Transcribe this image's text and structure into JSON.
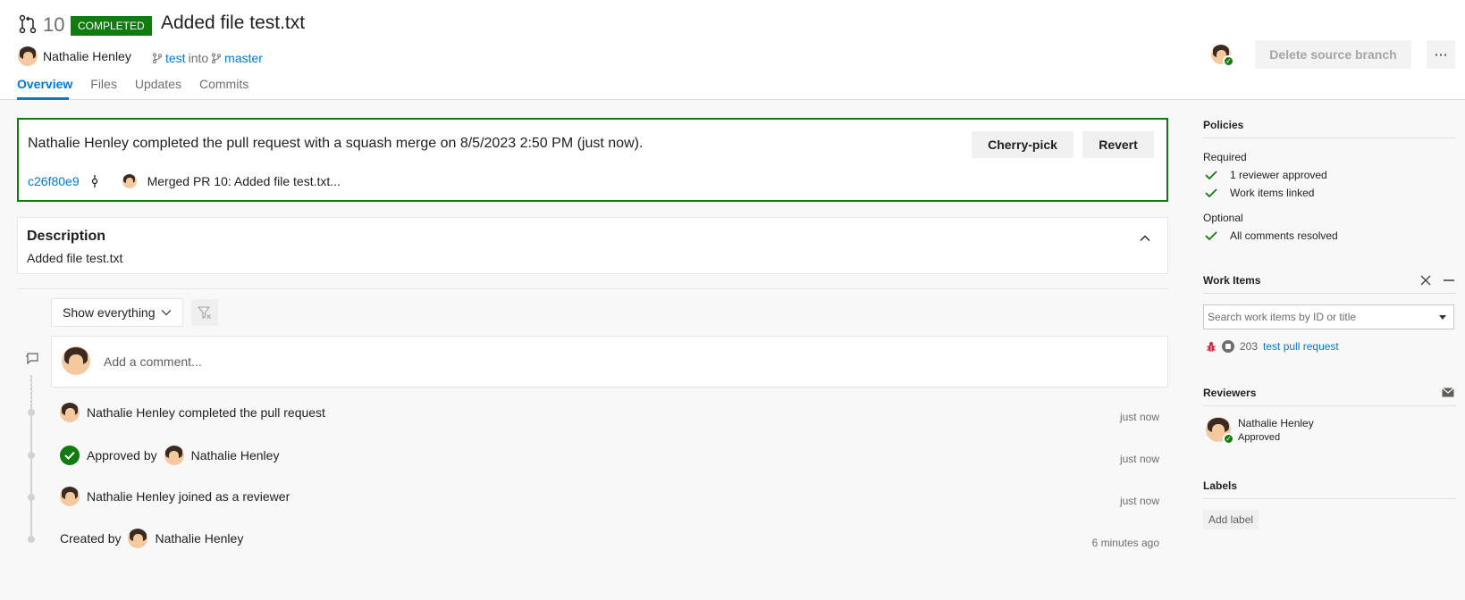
{
  "header": {
    "pr_number": "10",
    "status_badge": "COMPLETED",
    "title": "Added file test.txt",
    "author": "Nathalie Henley",
    "source_branch": "test",
    "into_text": "into",
    "target_branch": "master",
    "delete_branch_label": "Delete source branch",
    "more_label": "···"
  },
  "tabs": [
    {
      "label": "Overview",
      "active": true
    },
    {
      "label": "Files",
      "active": false
    },
    {
      "label": "Updates",
      "active": false
    },
    {
      "label": "Commits",
      "active": false
    }
  ],
  "merge": {
    "message": "Nathalie Henley completed the pull request with a squash merge on 8/5/2023 2:50 PM (just now).",
    "cherry_pick_label": "Cherry-pick",
    "revert_label": "Revert",
    "commit_id": "c26f80e9",
    "commit_message": "Merged PR 10: Added file test.txt..."
  },
  "description": {
    "title": "Description",
    "text": "Added file test.txt"
  },
  "filter": {
    "selected": "Show everything"
  },
  "comment": {
    "placeholder": "Add a comment..."
  },
  "timeline": [
    {
      "text": "Nathalie Henley completed the pull request",
      "time": "just now"
    },
    {
      "prefix": "Approved by",
      "name": "Nathalie Henley",
      "time": "just now"
    },
    {
      "text": "Nathalie Henley joined as a reviewer",
      "time": "just now"
    },
    {
      "prefix": "Created by",
      "name": "Nathalie Henley",
      "time": "6 minutes ago"
    }
  ],
  "sidebar": {
    "policies": {
      "title": "Policies",
      "required_label": "Required",
      "required": [
        "1 reviewer approved",
        "Work items linked"
      ],
      "optional_label": "Optional",
      "optional": [
        "All comments resolved"
      ]
    },
    "work_items": {
      "title": "Work Items",
      "search_placeholder": "Search work items by ID or title",
      "items": [
        {
          "id": "203",
          "title": "test pull request"
        }
      ]
    },
    "reviewers": {
      "title": "Reviewers",
      "items": [
        {
          "name": "Nathalie Henley",
          "status": "Approved"
        }
      ]
    },
    "labels": {
      "title": "Labels",
      "add_label": "Add label"
    }
  },
  "colors": {
    "accent": "#0078d4",
    "success": "#107c10",
    "text": "#201f1e",
    "muted": "#6e6e6e"
  }
}
